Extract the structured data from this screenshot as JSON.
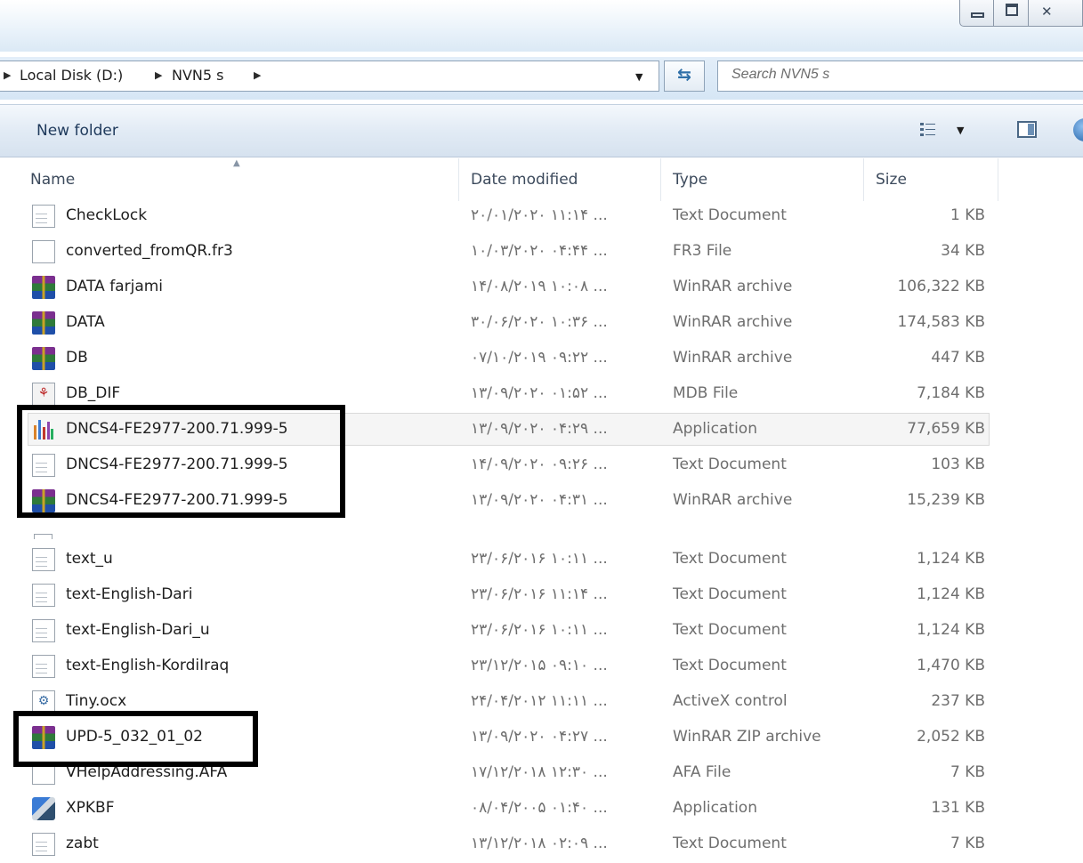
{
  "breadcrumb": [
    "Local Disk (D:)",
    "NVN5 s"
  ],
  "search": {
    "placeholder": "Search NVN5 s"
  },
  "toolbar": {
    "new_folder": "New folder"
  },
  "columns": {
    "name": "Name",
    "date": "Date modified",
    "type": "Type",
    "size": "Size"
  },
  "files": [
    {
      "name": "CheckLock",
      "date": "۲۰/۰۱/۲۰۲۰ ۱۱:۱۴ ...",
      "type": "Text Document",
      "size": "1 KB",
      "icon": "text-file-icon"
    },
    {
      "name": "converted_fromQR.fr3",
      "date": "۱۰/۰۳/۲۰۲۰ ۰۴:۴۴ ...",
      "type": "FR3 File",
      "size": "34 KB",
      "icon": "blank-file-icon"
    },
    {
      "name": "DATA farjami",
      "date": "۱۴/۰۸/۲۰۱۹ ۱۰:۰۸ ...",
      "type": "WinRAR archive",
      "size": "106,322 KB",
      "icon": "winrar-icon"
    },
    {
      "name": "DATA",
      "date": "۳۰/۰۶/۲۰۲۰ ۱۰:۳۶ ...",
      "type": "WinRAR archive",
      "size": "174,583 KB",
      "icon": "winrar-icon"
    },
    {
      "name": "DB",
      "date": "۰۷/۱۰/۲۰۱۹ ۰۹:۲۲ ...",
      "type": "WinRAR archive",
      "size": "447 KB",
      "icon": "winrar-icon"
    },
    {
      "name": "DB_DIF",
      "date": "۱۳/۰۹/۲۰۲۰ ۰۱:۵۲ ...",
      "type": "MDB File",
      "size": "7,184 KB",
      "icon": "access-db-icon"
    },
    {
      "name": "DNCS4-FE2977-200.71.999-5",
      "date": "۱۳/۰۹/۲۰۲۰ ۰۴:۲۹ ...",
      "type": "Application",
      "size": "77,659 KB",
      "icon": "app-bars-icon",
      "highlighted": true
    },
    {
      "name": "DNCS4-FE2977-200.71.999-5",
      "date": "۱۴/۰۹/۲۰۲۰ ۰۹:۲۶ ...",
      "type": "Text Document",
      "size": "103 KB",
      "icon": "text-file-icon"
    },
    {
      "name": "DNCS4-FE2977-200.71.999-5",
      "date": "۱۳/۰۹/۲۰۲۰ ۰۴:۳۱ ...",
      "type": "WinRAR archive",
      "size": "15,239 KB",
      "icon": "winrar-icon"
    },
    {
      "name": "text_u",
      "date": "۲۳/۰۶/۲۰۱۶ ۱۰:۱۱ ...",
      "type": "Text Document",
      "size": "1,124 KB",
      "icon": "text-file-icon"
    },
    {
      "name": "text-English-Dari",
      "date": "۲۳/۰۶/۲۰۱۶ ۱۱:۱۴ ...",
      "type": "Text Document",
      "size": "1,124 KB",
      "icon": "text-file-icon"
    },
    {
      "name": "text-English-Dari_u",
      "date": "۲۳/۰۶/۲۰۱۶ ۱۰:۱۱ ...",
      "type": "Text Document",
      "size": "1,124 KB",
      "icon": "text-file-icon"
    },
    {
      "name": "text-English-KordiIraq",
      "date": "۲۳/۱۲/۲۰۱۵ ۰۹:۱۰ ...",
      "type": "Text Document",
      "size": "1,470 KB",
      "icon": "text-file-icon"
    },
    {
      "name": "Tiny.ocx",
      "date": "۲۴/۰۴/۲۰۱۲ ۱۱:۱۱ ...",
      "type": "ActiveX control",
      "size": "237 KB",
      "icon": "activex-icon"
    },
    {
      "name": "UPD-5_032_01_02",
      "date": "۱۳/۰۹/۲۰۲۰ ۰۴:۲۷ ...",
      "type": "WinRAR ZIP archive",
      "size": "2,052 KB",
      "icon": "winrar-icon"
    },
    {
      "name": "VHelpAddressing.AFA",
      "date": "۱۷/۱۲/۲۰۱۸ ۱۲:۳۰ ...",
      "type": "AFA File",
      "size": "7 KB",
      "icon": "blank-file-icon"
    },
    {
      "name": "XPKBF",
      "date": "۰۸/۰۴/۲۰۰۵ ۰۱:۴۰ ...",
      "type": "Application",
      "size": "131 KB",
      "icon": "app-icon"
    },
    {
      "name": "zabt",
      "date": "۱۳/۱۲/۲۰۱۸ ۰۲:۰۹ ...",
      "type": "Text Document",
      "size": "7 KB",
      "icon": "text-file-icon"
    }
  ]
}
